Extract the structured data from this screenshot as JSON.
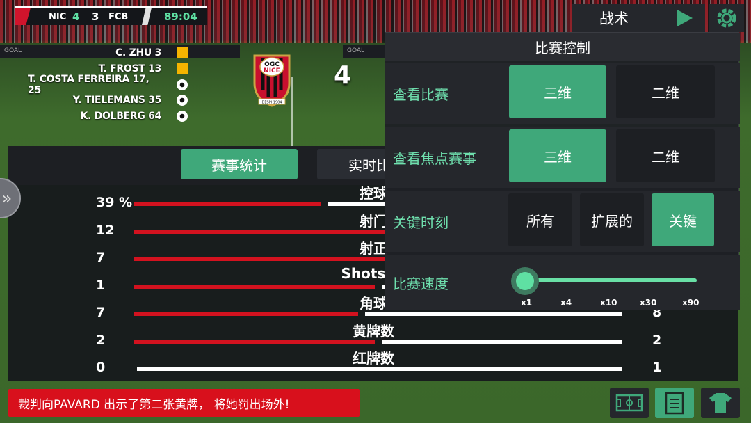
{
  "scoreboard": {
    "home_team": "NIC",
    "home_score": "4",
    "away_score": "3",
    "away_team": "FCB",
    "time": "89:04"
  },
  "scorers": [
    {
      "text": "C. ZHU 3",
      "event": "yellow-card"
    },
    {
      "text": "T. FROST 13",
      "event": "yellow-card"
    },
    {
      "text": "T. COSTA FERREIRA 17, 25",
      "event": "goal"
    },
    {
      "text": "Y. TIELEMANS 35",
      "event": "goal"
    },
    {
      "text": "K. DOLBERG 64",
      "event": "goal"
    }
  ],
  "crest": {
    "line1": "OGC",
    "line2": "NICE",
    "motto": "DESPI 1904"
  },
  "score_big": "4",
  "boards": {
    "left": "GOAL",
    "mid": "GOAL"
  },
  "tabs": {
    "stats": "赛事统计",
    "live": "实时比"
  },
  "stats": [
    {
      "title": "控球",
      "home": "39 %",
      "away": "",
      "home_val": 39,
      "away_val": 61
    },
    {
      "title": "射门",
      "home": "12",
      "away": "",
      "home_val": 12,
      "away_val": 6
    },
    {
      "title": "射正",
      "home": "7",
      "away": "",
      "home_val": 7,
      "away_val": 6
    },
    {
      "title": "Shots Bl",
      "home": "1",
      "away": "",
      "home_val": 1,
      "away_val": 1
    },
    {
      "title": "角球",
      "home": "7",
      "away": "8",
      "home_val": 7,
      "away_val": 8
    },
    {
      "title": "黄牌数",
      "home": "2",
      "away": "2",
      "home_val": 2,
      "away_val": 2
    },
    {
      "title": "红牌数",
      "home": "0",
      "away": "1",
      "home_val": 0,
      "away_val": 1
    }
  ],
  "tactics": {
    "label": "战术"
  },
  "match_control": {
    "title": "比赛控制",
    "view_match": {
      "label": "查看比赛",
      "opt1": "三维",
      "opt2": "二维"
    },
    "view_focus": {
      "label": "查看焦点赛事",
      "opt1": "三维",
      "opt2": "二维"
    },
    "key_moments": {
      "label": "关键时刻",
      "opt1": "所有",
      "opt2": "扩展的",
      "opt3": "关键"
    },
    "speed": {
      "label": "比赛速度",
      "ticks": [
        "x1",
        "x4",
        "x10",
        "x30",
        "x90"
      ],
      "selected": "x1"
    }
  },
  "notification": "裁判向PAVARD 出示了第二张黄牌， 将她罚出场外!",
  "colors": {
    "accent": "#3fa87a",
    "home": "#d3121f",
    "away": "#ffffff",
    "alert": "#d8101c"
  }
}
